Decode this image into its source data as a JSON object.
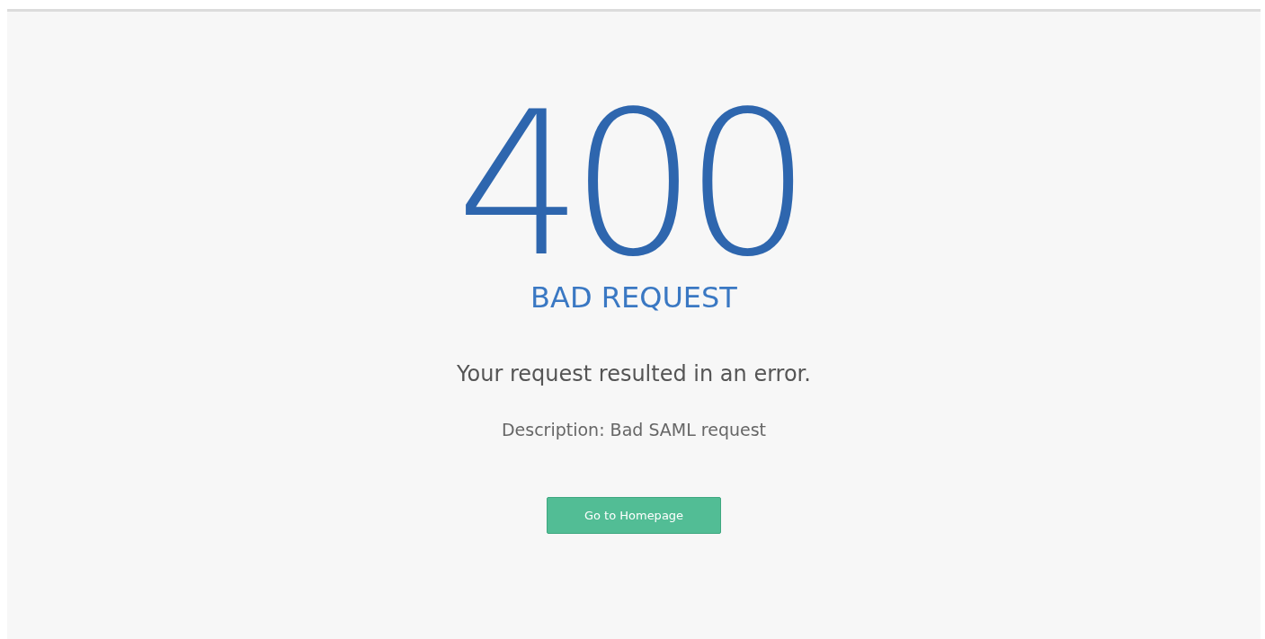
{
  "error": {
    "code": "400",
    "title": "BAD REQUEST",
    "message": "Your request resulted in an error.",
    "description": "Description: Bad SAML request"
  },
  "button": {
    "label": "Go to Homepage"
  }
}
